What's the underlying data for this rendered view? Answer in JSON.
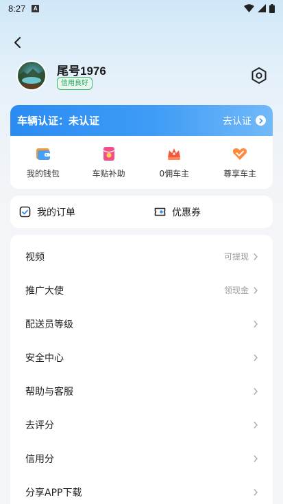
{
  "status_bar": {
    "time": "8:27",
    "notification_letter": "A"
  },
  "profile": {
    "nickname": "尾号1976",
    "credit_badge": "信用良好"
  },
  "auth": {
    "title": "车辆认证：未认证",
    "action": "去认证"
  },
  "quick_actions": [
    {
      "label": "我的钱包",
      "icon": "wallet-icon"
    },
    {
      "label": "车贴补助",
      "icon": "subsidy-envelope-icon"
    },
    {
      "label": "0佣车主",
      "icon": "crown-icon"
    },
    {
      "label": "尊享车主",
      "icon": "vip-heart-icon"
    }
  ],
  "orders": [
    {
      "label": "我的订单",
      "icon": "order-list-icon"
    },
    {
      "label": "优惠券",
      "icon": "coupon-icon"
    }
  ],
  "menu": [
    {
      "label": "视频",
      "hint": "可提现"
    },
    {
      "label": "推广大使",
      "hint": "领现金"
    },
    {
      "label": "配送员等级",
      "hint": ""
    },
    {
      "label": "安全中心",
      "hint": ""
    },
    {
      "label": "帮助与客服",
      "hint": ""
    },
    {
      "label": "去评分",
      "hint": ""
    },
    {
      "label": "信用分",
      "hint": ""
    },
    {
      "label": "分享APP下载",
      "hint": ""
    }
  ],
  "colors": {
    "accent_blue": "#2a8bf2",
    "credit_green": "#23a45a",
    "page_bg": "#f3f5f8"
  }
}
